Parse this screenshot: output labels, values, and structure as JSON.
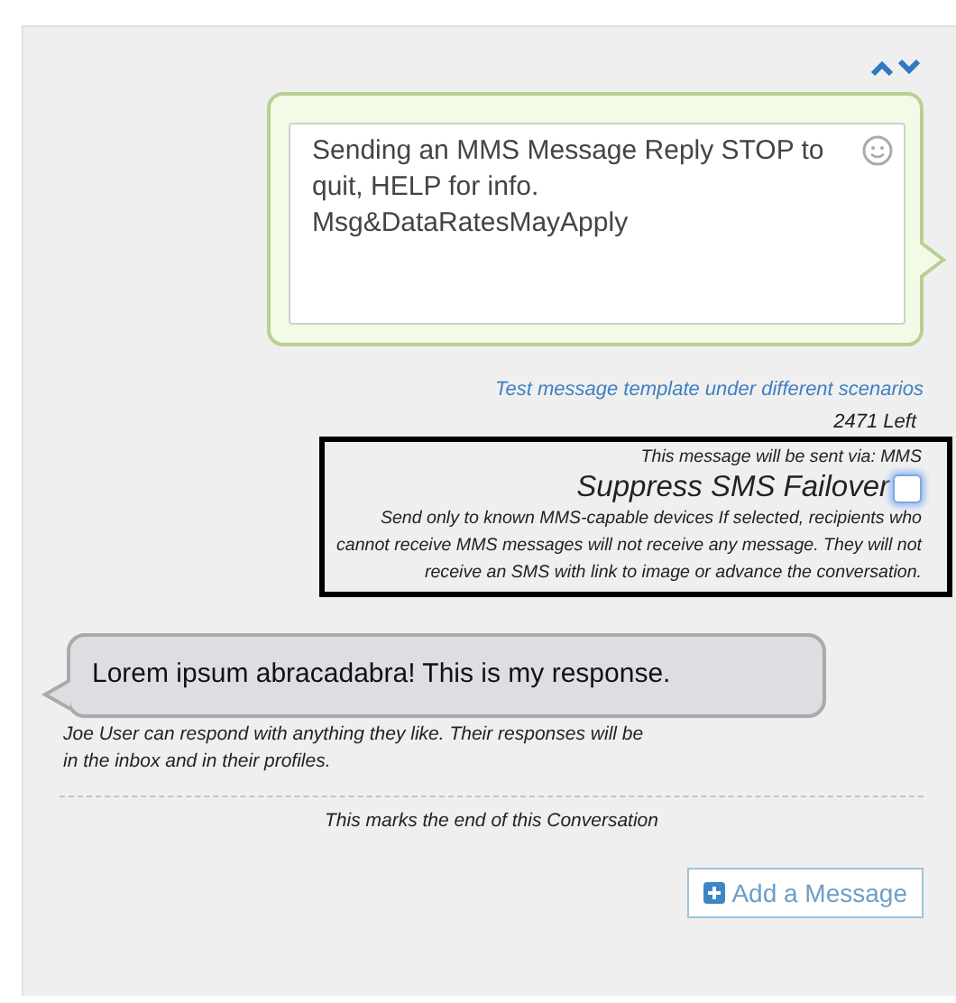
{
  "outgoing_message": {
    "text": "Sending an MMS Message Reply STOP to quit, HELP for info. Msg&DataRatesMayApply"
  },
  "test_link": "Test message template under different scenarios",
  "characters_left": "2471 Left",
  "delivery": {
    "sent_via": "This message will be sent via: MMS",
    "suppress_label": "Suppress SMS Failover",
    "suppress_checked": false,
    "description": "Send only to known MMS-capable devices If selected, recipients who cannot receive MMS messages will not receive any message. They will not receive an SMS with link to image or advance the conversation."
  },
  "response": {
    "text": "Lorem ipsum abracadabra! This is my response.",
    "caption": "Joe User can respond with anything they like. Their responses will be in the inbox and in their profiles."
  },
  "end_note": "This marks the end of this Conversation",
  "add_button": "Add a Message"
}
